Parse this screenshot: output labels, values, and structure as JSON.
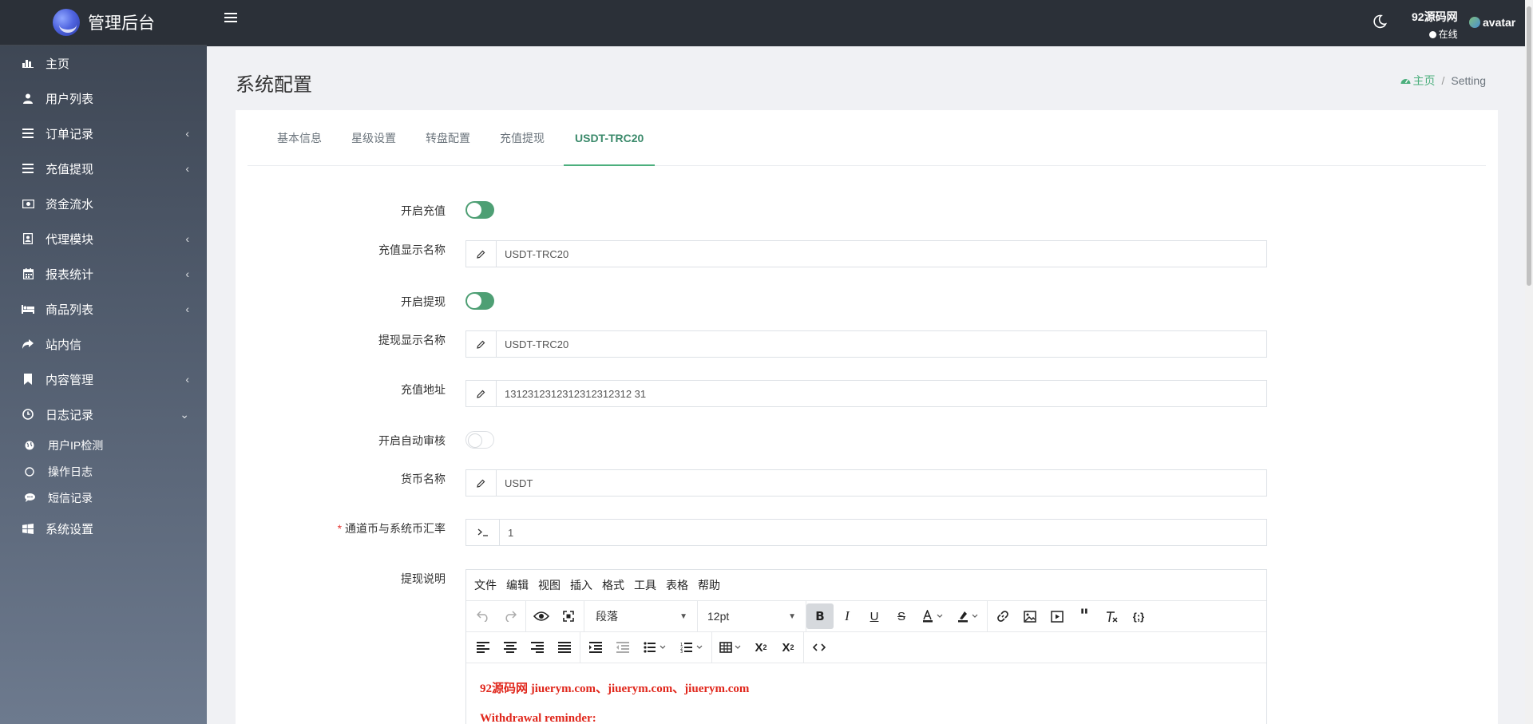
{
  "brand": {
    "title": "管理后台"
  },
  "sidebar": {
    "items": [
      {
        "label": "主页",
        "icon": "bar-chart-icon",
        "chevron": ""
      },
      {
        "label": "用户列表",
        "icon": "user-icon",
        "chevron": ""
      },
      {
        "label": "订单记录",
        "icon": "list-icon",
        "chevron": "‹"
      },
      {
        "label": "充值提现",
        "icon": "list-icon",
        "chevron": "‹"
      },
      {
        "label": "资金流水",
        "icon": "money-icon",
        "chevron": ""
      },
      {
        "label": "代理模块",
        "icon": "address-book-icon",
        "chevron": "‹"
      },
      {
        "label": "报表统计",
        "icon": "calendar-icon",
        "chevron": "‹"
      },
      {
        "label": "商品列表",
        "icon": "bed-icon",
        "chevron": "‹"
      },
      {
        "label": "站内信",
        "icon": "share-icon",
        "chevron": ""
      },
      {
        "label": "内容管理",
        "icon": "bookmark-icon",
        "chevron": "‹"
      },
      {
        "label": "日志记录",
        "icon": "clock-icon",
        "chevron": "⌄"
      }
    ],
    "sub_items": [
      {
        "label": "用户IP检测",
        "icon": "globe-icon"
      },
      {
        "label": "操作日志",
        "icon": "circle-icon"
      },
      {
        "label": "短信记录",
        "icon": "comment-icon"
      }
    ],
    "last_item": {
      "label": "系统设置",
      "icon": "windows-icon"
    }
  },
  "topbar": {
    "user_name": "92源码网",
    "user_status": "在线",
    "avatar_label": "avatar"
  },
  "page": {
    "title": "系统配置",
    "breadcrumb_home": "主页",
    "breadcrumb_current": "Setting"
  },
  "tabs": [
    {
      "label": "基本信息"
    },
    {
      "label": "星级设置"
    },
    {
      "label": "转盘配置"
    },
    {
      "label": "充值提现"
    },
    {
      "label": "USDT-TRC20"
    }
  ],
  "form": {
    "enable_recharge": {
      "label": "开启充值",
      "on": true
    },
    "recharge_name": {
      "label": "充值显示名称",
      "value": "USDT-TRC20"
    },
    "enable_withdraw": {
      "label": "开启提现",
      "on": true
    },
    "withdraw_name": {
      "label": "提现显示名称",
      "value": "USDT-TRC20"
    },
    "recharge_address": {
      "label": "充值地址",
      "value": "1312312312312312312312 31"
    },
    "auto_audit": {
      "label": "开启自动审核",
      "on": false
    },
    "currency_name": {
      "label": "货币名称",
      "value": "USDT"
    },
    "exchange_rate": {
      "required_mark": "*",
      "label": "通道币与系统币汇率",
      "value": "1"
    },
    "withdraw_desc": {
      "label": "提现说明"
    }
  },
  "editor": {
    "menus": [
      "文件",
      "编辑",
      "视图",
      "插入",
      "格式",
      "工具",
      "表格",
      "帮助"
    ],
    "block_format": "段落",
    "font_size": "12pt",
    "content_line1": "92源码网 jiuerym.com、jiuerym.com、jiuerym.com",
    "content_line2": "Withdrawal reminder:"
  }
}
